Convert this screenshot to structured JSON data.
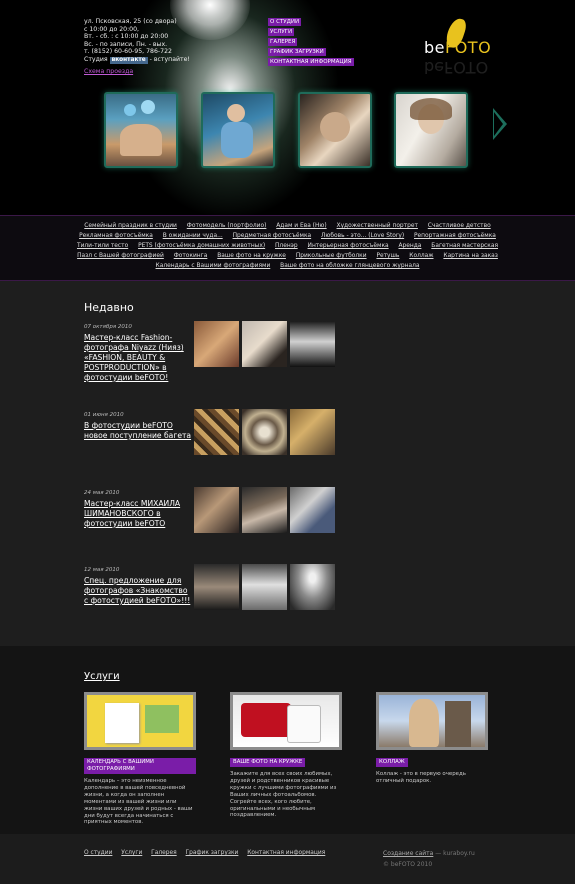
{
  "header": {
    "contacts": {
      "address": "ул. Псковская, 25 (со двора)",
      "hours_1": "с 10:00 до 20:00,",
      "hours_2": "Вт. - сб. : с 10:00 до 20:00",
      "hours_3": "Вс. - по записи, Пн. - вых.",
      "phone": "т. (8152) 60-60-95, 786-722",
      "studio_prefix": "Студия",
      "vk_label": "вконтакте",
      "studio_suffix": "- вступайте!",
      "scheme_link": "Схема проезда"
    },
    "nav": [
      "О СТУДИИ",
      "УСЛУГИ",
      "ГАЛЕРЕЯ",
      "ГРАФИК ЗАГРУЗКИ",
      "КОНТАКТНАЯ ИНФОРМАЦИЯ"
    ],
    "logo": {
      "text_be": "be",
      "text_foto": "FOTO"
    }
  },
  "categories": {
    "row1": [
      "Семейный праздник в студии",
      "Фотомодель (портфолио)",
      "Адам и Ева (Ню)",
      "Художественный портрет",
      "Счастливое детство"
    ],
    "row2": [
      "Рекламная фотосъёмка",
      "В ожидании чуда...",
      "Предметная фотосъёмка",
      "Любовь - это... (Love Story)",
      "Репортажная фотосъёмка"
    ],
    "row3": [
      "Тили-тили тесто",
      "PETS (фотосъёмка домашних животных)",
      "Пленэр",
      "Интерьерная фотосъёмка",
      "Аренда",
      "Багетная мастерская"
    ],
    "row4": [
      "Пазл с Вашей фотографией",
      "Фотокинга",
      "Ваше фото на кружке",
      "Прикольные футболки",
      "Ретушь",
      "Коллаж",
      "Картина на заказ"
    ],
    "row5": [
      "Календарь с Вашими фотографиями",
      "Ваше фото на обложке глянцевого журнала"
    ]
  },
  "recent": {
    "title": "Недавно",
    "items": [
      {
        "date": "07 октября 2010",
        "title": "Мастер-класс Fashion-фотографа Niyazz (Нияз) «FASHION, BEAUTY & POSTPRODUCTION» в фотостудии beFOTO!"
      },
      {
        "date": "01 июня 2010",
        "title": "В фотостудии beFOTO новое поступление багета"
      },
      {
        "date": "24 мая 2010",
        "title": "Мастер-класс МИХАИЛА ШИМАНОВСКОГО в фотостудии beFOTO"
      },
      {
        "date": "12 мая 2010",
        "title": "Спец. предложение для фотографов «Знакомство с фотостудией beFOTO»!!!"
      }
    ]
  },
  "services": {
    "title": "Услуги",
    "items": [
      {
        "label": "КАЛЕНДАРЬ С ВАШИМИ ФОТОГРАФИЯМИ",
        "desc": "Календарь – это неизменное дополнение в вашей повседневной жизни, а когда он заполнен моментами из вашей жизни или жизни ваших друзей и родных - ваши дни будут всегда начинаться с приятных моментов."
      },
      {
        "label": "ВАШЕ ФОТО НА КРУЖКЕ",
        "desc": "Закажите для всех своих любимых, друзей и родственников красивые кружки с лучшими фотографиями из Ваших личных фотоальбомов. Согрейте всех, кого любите, оригинальными и необычным поздравлением."
      },
      {
        "label": "КОЛЛАЖ",
        "desc": "Коллаж - это в первую очередь отличный подарок."
      }
    ]
  },
  "footer": {
    "links": [
      "О студии",
      "Услуги",
      "Галерея",
      "График загрузки",
      "Контактная информация"
    ],
    "credit_link": "Создание сайта",
    "credit_suffix": " — kuraboy.ru",
    "copyright": "© beFOTO 2010"
  },
  "colors": {
    "accent_purple": "#7a1da8",
    "glow_teal": "#1f6b5a",
    "logo_yellow": "#e8c21e"
  }
}
